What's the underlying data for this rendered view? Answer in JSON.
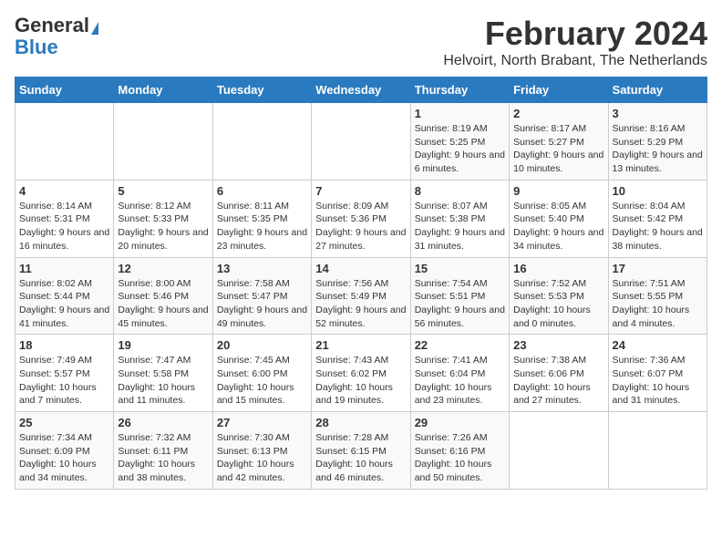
{
  "logo": {
    "general": "General",
    "blue": "Blue"
  },
  "title": "February 2024",
  "subtitle": "Helvoirt, North Brabant, The Netherlands",
  "weekdays": [
    "Sunday",
    "Monday",
    "Tuesday",
    "Wednesday",
    "Thursday",
    "Friday",
    "Saturday"
  ],
  "weeks": [
    [
      {
        "day": "",
        "info": ""
      },
      {
        "day": "",
        "info": ""
      },
      {
        "day": "",
        "info": ""
      },
      {
        "day": "",
        "info": ""
      },
      {
        "day": "1",
        "info": "Sunrise: 8:19 AM\nSunset: 5:25 PM\nDaylight: 9 hours and 6 minutes."
      },
      {
        "day": "2",
        "info": "Sunrise: 8:17 AM\nSunset: 5:27 PM\nDaylight: 9 hours and 10 minutes."
      },
      {
        "day": "3",
        "info": "Sunrise: 8:16 AM\nSunset: 5:29 PM\nDaylight: 9 hours and 13 minutes."
      }
    ],
    [
      {
        "day": "4",
        "info": "Sunrise: 8:14 AM\nSunset: 5:31 PM\nDaylight: 9 hours and 16 minutes."
      },
      {
        "day": "5",
        "info": "Sunrise: 8:12 AM\nSunset: 5:33 PM\nDaylight: 9 hours and 20 minutes."
      },
      {
        "day": "6",
        "info": "Sunrise: 8:11 AM\nSunset: 5:35 PM\nDaylight: 9 hours and 23 minutes."
      },
      {
        "day": "7",
        "info": "Sunrise: 8:09 AM\nSunset: 5:36 PM\nDaylight: 9 hours and 27 minutes."
      },
      {
        "day": "8",
        "info": "Sunrise: 8:07 AM\nSunset: 5:38 PM\nDaylight: 9 hours and 31 minutes."
      },
      {
        "day": "9",
        "info": "Sunrise: 8:05 AM\nSunset: 5:40 PM\nDaylight: 9 hours and 34 minutes."
      },
      {
        "day": "10",
        "info": "Sunrise: 8:04 AM\nSunset: 5:42 PM\nDaylight: 9 hours and 38 minutes."
      }
    ],
    [
      {
        "day": "11",
        "info": "Sunrise: 8:02 AM\nSunset: 5:44 PM\nDaylight: 9 hours and 41 minutes."
      },
      {
        "day": "12",
        "info": "Sunrise: 8:00 AM\nSunset: 5:46 PM\nDaylight: 9 hours and 45 minutes."
      },
      {
        "day": "13",
        "info": "Sunrise: 7:58 AM\nSunset: 5:47 PM\nDaylight: 9 hours and 49 minutes."
      },
      {
        "day": "14",
        "info": "Sunrise: 7:56 AM\nSunset: 5:49 PM\nDaylight: 9 hours and 52 minutes."
      },
      {
        "day": "15",
        "info": "Sunrise: 7:54 AM\nSunset: 5:51 PM\nDaylight: 9 hours and 56 minutes."
      },
      {
        "day": "16",
        "info": "Sunrise: 7:52 AM\nSunset: 5:53 PM\nDaylight: 10 hours and 0 minutes."
      },
      {
        "day": "17",
        "info": "Sunrise: 7:51 AM\nSunset: 5:55 PM\nDaylight: 10 hours and 4 minutes."
      }
    ],
    [
      {
        "day": "18",
        "info": "Sunrise: 7:49 AM\nSunset: 5:57 PM\nDaylight: 10 hours and 7 minutes."
      },
      {
        "day": "19",
        "info": "Sunrise: 7:47 AM\nSunset: 5:58 PM\nDaylight: 10 hours and 11 minutes."
      },
      {
        "day": "20",
        "info": "Sunrise: 7:45 AM\nSunset: 6:00 PM\nDaylight: 10 hours and 15 minutes."
      },
      {
        "day": "21",
        "info": "Sunrise: 7:43 AM\nSunset: 6:02 PM\nDaylight: 10 hours and 19 minutes."
      },
      {
        "day": "22",
        "info": "Sunrise: 7:41 AM\nSunset: 6:04 PM\nDaylight: 10 hours and 23 minutes."
      },
      {
        "day": "23",
        "info": "Sunrise: 7:38 AM\nSunset: 6:06 PM\nDaylight: 10 hours and 27 minutes."
      },
      {
        "day": "24",
        "info": "Sunrise: 7:36 AM\nSunset: 6:07 PM\nDaylight: 10 hours and 31 minutes."
      }
    ],
    [
      {
        "day": "25",
        "info": "Sunrise: 7:34 AM\nSunset: 6:09 PM\nDaylight: 10 hours and 34 minutes."
      },
      {
        "day": "26",
        "info": "Sunrise: 7:32 AM\nSunset: 6:11 PM\nDaylight: 10 hours and 38 minutes."
      },
      {
        "day": "27",
        "info": "Sunrise: 7:30 AM\nSunset: 6:13 PM\nDaylight: 10 hours and 42 minutes."
      },
      {
        "day": "28",
        "info": "Sunrise: 7:28 AM\nSunset: 6:15 PM\nDaylight: 10 hours and 46 minutes."
      },
      {
        "day": "29",
        "info": "Sunrise: 7:26 AM\nSunset: 6:16 PM\nDaylight: 10 hours and 50 minutes."
      },
      {
        "day": "",
        "info": ""
      },
      {
        "day": "",
        "info": ""
      }
    ]
  ]
}
